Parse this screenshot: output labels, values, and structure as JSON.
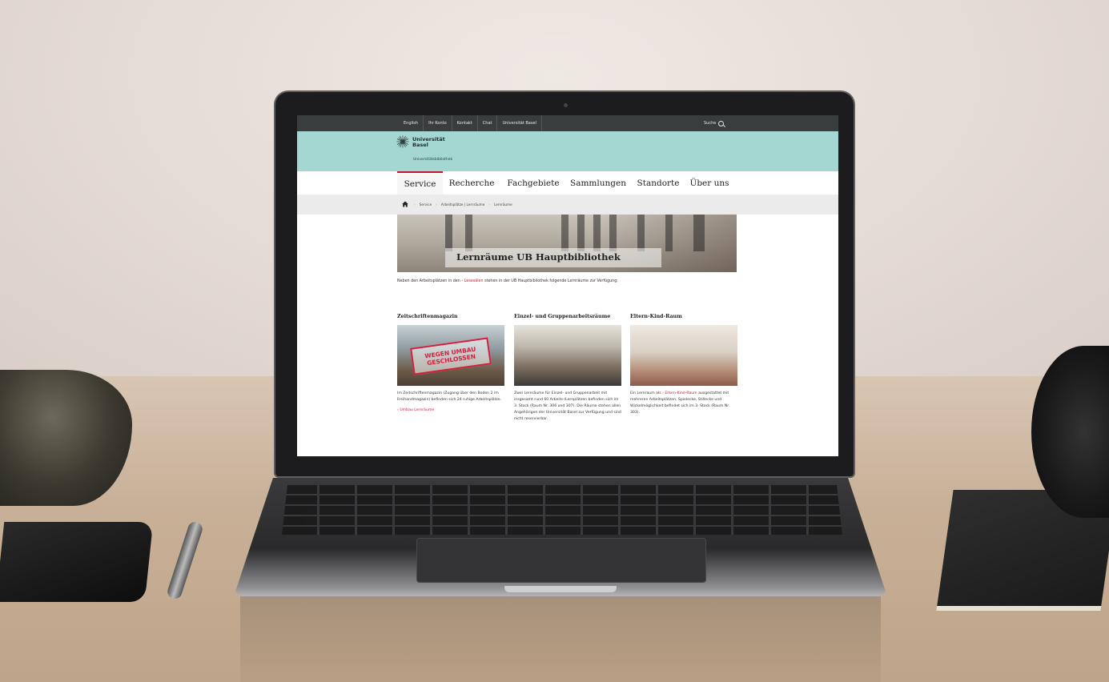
{
  "topbar": {
    "links": [
      "English",
      "Ihr Konto",
      "Kontakt",
      "Chat",
      "Universität Basel"
    ],
    "search_label": "Suche"
  },
  "brand": {
    "name_line1": "Universität",
    "name_line2": "Basel",
    "subtitle": "Universitätsbibliothek"
  },
  "mainnav": {
    "items": [
      "Service",
      "Recherche",
      "Fachgebiete",
      "Sammlungen",
      "Standorte",
      "Über uns"
    ],
    "active": "Service"
  },
  "breadcrumb": [
    "Service",
    "Arbeitsplätze | Lernräume",
    "Lernräume"
  ],
  "hero": {
    "title": "Lernräume UB Hauptbibliothek"
  },
  "intro": {
    "before": "Neben den Arbeitsplätzen in den ",
    "link": "Lesesälen",
    "after": " stehen in der UB Hauptbibliothek folgende Lernräume zur Verfügung:"
  },
  "cards": [
    {
      "title": "Zeitschriftenmagazin",
      "stamp_line1": "WEGEN UMBAU",
      "stamp_line2": "GESCHLOSSEN",
      "text": "Im Zeitschriftenmagazin (Zugang über den Boden 2 im Freihandmagazin) befinden sich 24 ruhige Arbeitsplätze.",
      "link": "Umbau Lernräume"
    },
    {
      "title": "Einzel- und Gruppenarbeitsräume",
      "text": "Zwei Lernräume für Einzel- und Gruppenarbeit mit insgesamt rund 60 Arbeits-/Lernplätzen befinden sich im 3. Stock (Raum Nr. 306 und 307). Die Räume stehen allen Angehörigen der Universität Basel zur Verfügung und sind nicht reservierbar."
    },
    {
      "title": "Eltern-Kind-Raum",
      "text_before": "Ein Lernraum als ",
      "link": "Eltern-Kind-Raum",
      "text_after": " ausgestattet mit mehreren Arbeitsplätzen, Spielecke, Stillecke und Wickelmöglichkeit befindet sich im 3. Stock (Raum Nr. 303)."
    }
  ],
  "colors": {
    "brand_band": "#a5d7d2",
    "topbar": "#3a3d3d",
    "accent_red": "#d1163a"
  }
}
